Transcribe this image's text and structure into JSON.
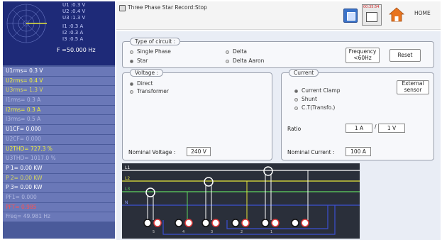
{
  "sidebar": {
    "scope_values": [
      "U1 :0.3  V",
      "U2 :0.4  V",
      "U3 :1.3  V",
      "I1 :0.3  A",
      "I2 :0.3  A",
      "I3 :0.5  A"
    ],
    "frequency": "F  =50.000 Hz",
    "measurements": [
      {
        "text": "U1rms=  0.3  V",
        "tone": "white"
      },
      {
        "text": "U2rms=  0.4  V",
        "tone": "yellow"
      },
      {
        "text": "U3rms=  1.3  V",
        "tone": "dimyellow"
      },
      {
        "text": "I1rms=  0.3  A",
        "tone": "dimgrey"
      },
      {
        "text": "I2rms=  0.3  A",
        "tone": "yellow"
      },
      {
        "text": "I3rms=  0.5  A",
        "tone": "dimgrey"
      },
      {
        "text": "U1CF=  0.000",
        "tone": "white"
      },
      {
        "text": "U2CF=  0.000",
        "tone": "dimgrey"
      },
      {
        "text": "U2THD=  727.3  %",
        "tone": "yellow"
      },
      {
        "text": "U3THD=  1017.0  %",
        "tone": "dimgrey"
      },
      {
        "text": "P 1=  0.00  KW",
        "tone": "white"
      },
      {
        "text": "P 2=  0.00  KW",
        "tone": "dimyellow"
      },
      {
        "text": "P 3=  0.00  KW",
        "tone": "white"
      },
      {
        "text": "PF1=  0.000",
        "tone": "dimgrey"
      },
      {
        "text": "PFT=  0.985",
        "tone": "red"
      },
      {
        "text": "Freq=  49.981  Hz",
        "tone": "dimgrey"
      }
    ]
  },
  "header": {
    "title": "Three Phase Star Record:Stop",
    "clock": "00:35:54",
    "home_label": "HOME"
  },
  "circuit": {
    "legend": "Type of circuit :",
    "options": [
      {
        "label": "Single Phase",
        "selected": false
      },
      {
        "label": "Delta",
        "selected": false
      },
      {
        "label": "Star",
        "selected": true
      },
      {
        "label": "Delta Aaron",
        "selected": false
      }
    ],
    "frequency_btn": [
      "Frequency",
      "<60Hz"
    ],
    "reset_btn": "Reset"
  },
  "voltage": {
    "legend": "Voltage :",
    "options": [
      {
        "label": "Direct",
        "selected": true
      },
      {
        "label": "Transformer",
        "selected": false
      }
    ],
    "nominal_label": "Nominal Voltage :",
    "nominal_value": "240 V"
  },
  "current": {
    "legend": "Current",
    "options": [
      {
        "label": "Current Clamp",
        "selected": true
      },
      {
        "label": "Shunt",
        "selected": false
      },
      {
        "label": "C.T(Transfo.)",
        "selected": false
      }
    ],
    "external_btn": [
      "External",
      "sensor"
    ],
    "ratio_label": "Ratio",
    "ratio_primary": "1 A",
    "ratio_sep": "/",
    "ratio_secondary": "1 V",
    "nominal_label": "Nominal Current :",
    "nominal_value": "100 A"
  },
  "diagram": {
    "lines": [
      "L1",
      "L2",
      "L3",
      "N"
    ],
    "terminal_numbers": [
      "5",
      "4",
      "3",
      "2",
      "1"
    ]
  },
  "colors": {
    "sidebar_bg": "#4a5a9a",
    "scope_bg": "#1e2a78",
    "panel_bg": "#e9edf5",
    "l1": "#ffffff",
    "l2": "#e6e63a",
    "l3": "#5fd35f",
    "neutral": "#3c50d2",
    "terminal_red": "#e03a3a"
  }
}
